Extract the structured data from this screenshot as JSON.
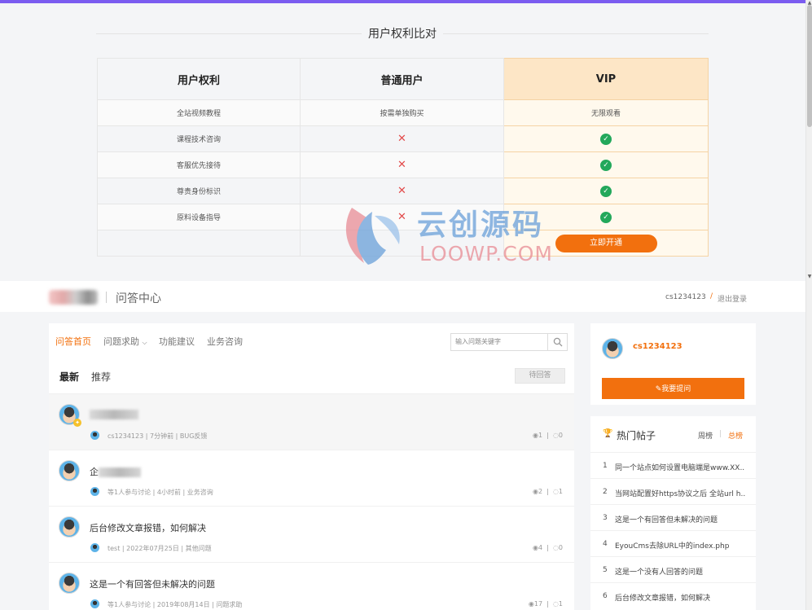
{
  "colors": {
    "accent": "#f2700e",
    "top_bar": "#7b5cf0",
    "check": "#23a85b",
    "cross": "#e24a4a",
    "vip_header": "#fde6c6"
  },
  "compare": {
    "title": "用户权利比对",
    "headers": [
      "用户权利",
      "普通用户",
      "VIP"
    ],
    "rows": [
      {
        "right": "全站视频教程",
        "normal": "按需单独购买",
        "vip": "无限观看"
      },
      {
        "right": "课程技术咨询",
        "normal": "✕",
        "vip": "✓"
      },
      {
        "right": "客服优先接待",
        "normal": "✕",
        "vip": "✓"
      },
      {
        "right": "尊贵身份标识",
        "normal": "✕",
        "vip": "✓"
      },
      {
        "right": "原料设备指导",
        "normal": "✕",
        "vip": "✓"
      }
    ],
    "open_button": "立即开通"
  },
  "watermark": {
    "cn": "云创源码",
    "en": "LOOWP.COM"
  },
  "header": {
    "title": "问答中心",
    "username": "cs1234123",
    "slash": "/",
    "logout": "退出登录"
  },
  "nav": {
    "items": [
      "问答首页",
      "问题求助",
      "功能建议",
      "业务咨询"
    ],
    "search_placeholder": "输入问题关键字"
  },
  "tabs": {
    "latest": "最新",
    "recommend": "推荐",
    "pending": "待回答"
  },
  "questions": [
    {
      "title": "",
      "meta": "cs1234123 | 7分钟前 | BUG反馈",
      "views": "1",
      "replies": "0"
    },
    {
      "title": "企",
      "meta": "等1人参与讨论 | 4小时前 | 业务咨询",
      "views": "2",
      "replies": "1"
    },
    {
      "title": "后台修改文章报错，如何解决",
      "meta": "test | 2022年07月25日 | 其他问题",
      "views": "4",
      "replies": "0"
    },
    {
      "title": "这是一个有回答但未解决的问题",
      "meta": "等1人参与讨论 | 2019年08月14日 | 问题求助",
      "views": "17",
      "replies": "1"
    }
  ],
  "sidebar": {
    "username": "cs1234123",
    "ask_button": "✎我要提问",
    "hot": {
      "title": "热门帖子",
      "tab_week": "周榜",
      "tab_total": "总榜",
      "items": [
        "同一个站点如何设置电脑端是www.XX...",
        "当网站配置好https协议之后 全站url h...",
        "这是一个有回答但未解决的问题",
        "EyouCms去除URL中的index.php",
        "这是一个没有人回答的问题",
        "后台修改文章报错，如何解决"
      ]
    }
  }
}
